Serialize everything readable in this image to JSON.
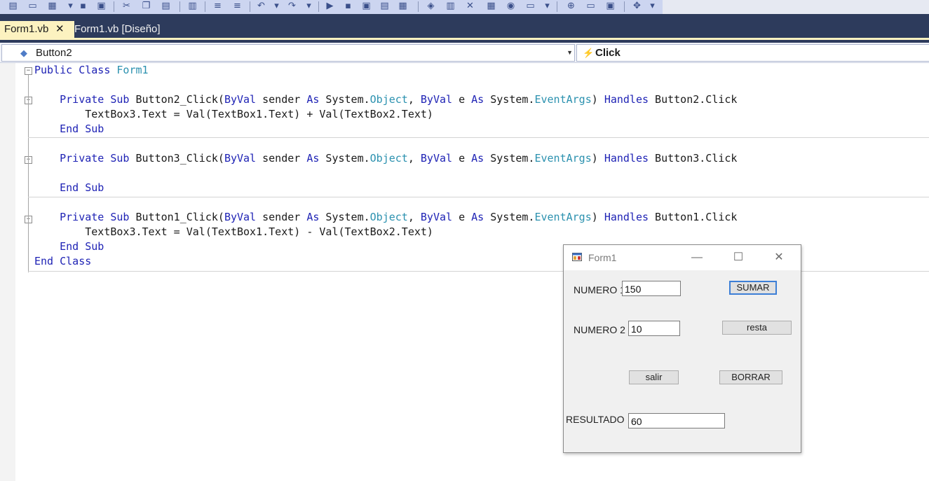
{
  "tabs": [
    {
      "label": "Form1.vb",
      "close": "✕"
    },
    {
      "label": "Form1.vb [Diseño]"
    }
  ],
  "nav": {
    "object": "Button2",
    "member": "Click"
  },
  "toolbar": {
    "icons": [
      "copy-icon",
      "open-icon",
      "window-icon",
      "save-icon",
      "save-all-icon",
      "cut-icon",
      "copy-icon",
      "paste-icon",
      "find-icon",
      "comment-icon",
      "uncomment-icon",
      "undo-icon",
      "redo-icon",
      "start-icon",
      "step-icon",
      "breakpoint-icon",
      "bookmark-icon",
      "solution-explorer-icon",
      "properties-icon",
      "toolbox-icon",
      "error-list-icon",
      "output-icon",
      "more-icon",
      "class-view-icon",
      "immediate-icon",
      "stack-icon",
      "customize-icon"
    ]
  },
  "code": {
    "lines": [
      [
        [
          "kw",
          "Public"
        ],
        [
          "t",
          " "
        ],
        [
          "kw",
          "Class"
        ],
        [
          "t",
          " "
        ],
        [
          "ty",
          "Form1"
        ]
      ],
      [],
      [
        [
          "t",
          "    "
        ],
        [
          "kw",
          "Private"
        ],
        [
          "t",
          " "
        ],
        [
          "kw",
          "Sub"
        ],
        [
          "t",
          " Button2_Click("
        ],
        [
          "kw",
          "ByVal"
        ],
        [
          "t",
          " sender "
        ],
        [
          "kw",
          "As"
        ],
        [
          "t",
          " System."
        ],
        [
          "ty",
          "Object"
        ],
        [
          "t",
          ", "
        ],
        [
          "kw",
          "ByVal"
        ],
        [
          "t",
          " e "
        ],
        [
          "kw",
          "As"
        ],
        [
          "t",
          " System."
        ],
        [
          "ty",
          "EventArgs"
        ],
        [
          "t",
          ") "
        ],
        [
          "kw",
          "Handles"
        ],
        [
          "t",
          " Button2.Click"
        ]
      ],
      [
        [
          "t",
          "        TextBox3.Text = Val(TextBox1.Text) + Val(TextBox2.Text)"
        ]
      ],
      [
        [
          "t",
          "    "
        ],
        [
          "kw",
          "End"
        ],
        [
          "t",
          " "
        ],
        [
          "kw",
          "Sub"
        ]
      ],
      [],
      [
        [
          "t",
          "    "
        ],
        [
          "kw",
          "Private"
        ],
        [
          "t",
          " "
        ],
        [
          "kw",
          "Sub"
        ],
        [
          "t",
          " Button3_Click("
        ],
        [
          "kw",
          "ByVal"
        ],
        [
          "t",
          " sender "
        ],
        [
          "kw",
          "As"
        ],
        [
          "t",
          " System."
        ],
        [
          "ty",
          "Object"
        ],
        [
          "t",
          ", "
        ],
        [
          "kw",
          "ByVal"
        ],
        [
          "t",
          " e "
        ],
        [
          "kw",
          "As"
        ],
        [
          "t",
          " System."
        ],
        [
          "ty",
          "EventArgs"
        ],
        [
          "t",
          ") "
        ],
        [
          "kw",
          "Handles"
        ],
        [
          "t",
          " Button3.Click"
        ]
      ],
      [],
      [
        [
          "t",
          "    "
        ],
        [
          "kw",
          "End"
        ],
        [
          "t",
          " "
        ],
        [
          "kw",
          "Sub"
        ]
      ],
      [],
      [
        [
          "t",
          "    "
        ],
        [
          "kw",
          "Private"
        ],
        [
          "t",
          " "
        ],
        [
          "kw",
          "Sub"
        ],
        [
          "t",
          " Button1_Click("
        ],
        [
          "kw",
          "ByVal"
        ],
        [
          "t",
          " sender "
        ],
        [
          "kw",
          "As"
        ],
        [
          "t",
          " System."
        ],
        [
          "ty",
          "Object"
        ],
        [
          "t",
          ", "
        ],
        [
          "kw",
          "ByVal"
        ],
        [
          "t",
          " e "
        ],
        [
          "kw",
          "As"
        ],
        [
          "t",
          " System."
        ],
        [
          "ty",
          "EventArgs"
        ],
        [
          "t",
          ") "
        ],
        [
          "kw",
          "Handles"
        ],
        [
          "t",
          " Button1.Click"
        ]
      ],
      [
        [
          "t",
          "        TextBox3.Text = Val(TextBox1.Text) - Val(TextBox2.Text)"
        ]
      ],
      [
        [
          "t",
          "    "
        ],
        [
          "kw",
          "End"
        ],
        [
          "t",
          " "
        ],
        [
          "kw",
          "Sub"
        ]
      ],
      [
        [
          "kw",
          "End"
        ],
        [
          "t",
          " "
        ],
        [
          "kw",
          "Class"
        ]
      ]
    ]
  },
  "form": {
    "title": "Form1",
    "minimize": "—",
    "maximize": "☐",
    "close": "✕",
    "label1": "NUMERO 1",
    "textbox1": "150",
    "label2": "NUMERO 2",
    "textbox2": "10",
    "label3": "RESULTADO",
    "textbox3": "60",
    "btn_sumar": "SUMAR",
    "btn_resta": "resta",
    "btn_salir": "salir",
    "btn_borrar": "BORRAR"
  },
  "colors": {
    "keyword": "#1f23b5",
    "type": "#2b91af",
    "tab_active": "#fcf2c0",
    "tabstrip": "#2d3b5c"
  }
}
